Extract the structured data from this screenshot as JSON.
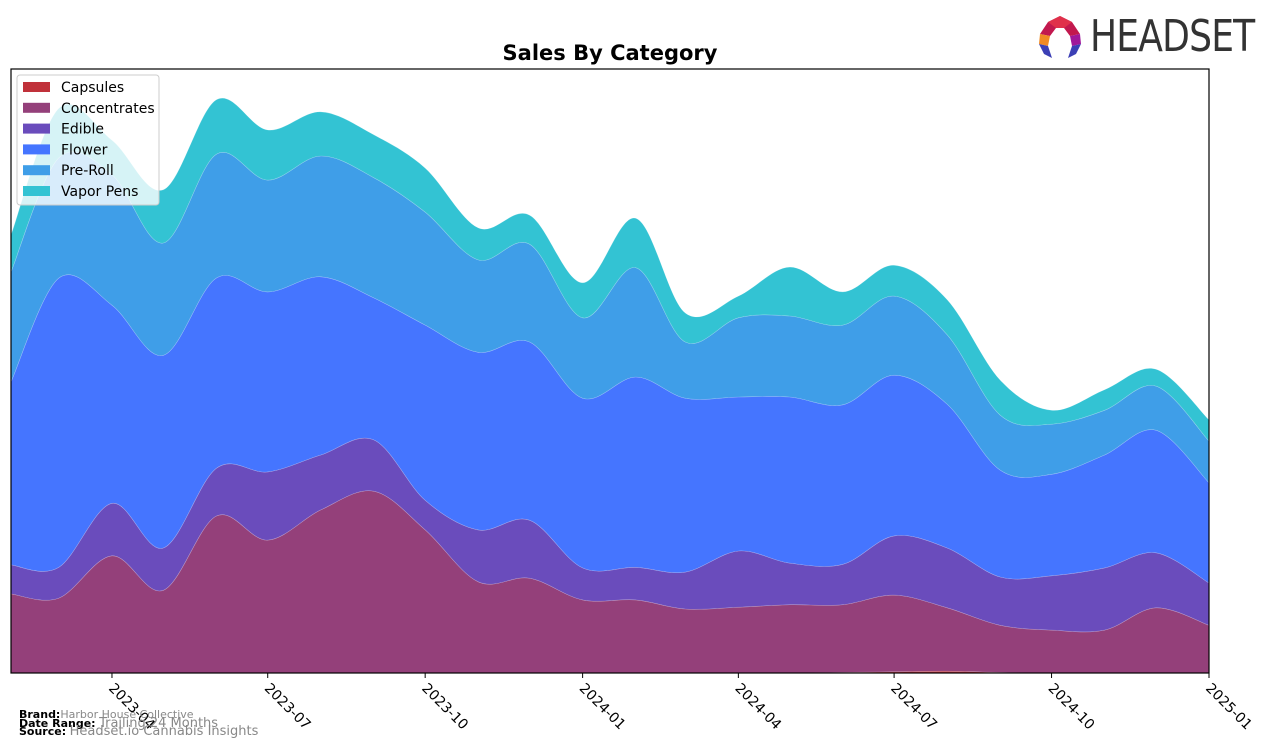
{
  "brand_logo": {
    "text": "HEADSET"
  },
  "footer": {
    "brand_label": "Brand:",
    "brand_value": "Harbor House Collective",
    "range_label": "Date Range:",
    "range_value": "Trailing 24 Months",
    "source_label": "Source:",
    "source_value": "Headset.io Cannabis Insights"
  },
  "chart_data": {
    "type": "area",
    "stacked": true,
    "smoothed": true,
    "title": "Sales By Category",
    "xlabel": "",
    "ylabel": "",
    "ylim": [
      0,
      100
    ],
    "grid": false,
    "legend_position": "top-left",
    "x": [
      "2023-02",
      "2023-03",
      "2023-04",
      "2023-05",
      "2023-06",
      "2023-07",
      "2023-08",
      "2023-09",
      "2023-10",
      "2023-11",
      "2023-12",
      "2024-01",
      "2024-02",
      "2024-03",
      "2024-04",
      "2024-05",
      "2024-06",
      "2024-07",
      "2024-08",
      "2024-09",
      "2024-10",
      "2024-11",
      "2024-12",
      "2025-01"
    ],
    "xticks": [
      "2023-04",
      "2023-07",
      "2023-10",
      "2024-01",
      "2024-04",
      "2024-07",
      "2024-10",
      "2025-01"
    ],
    "series": [
      {
        "name": "Capsules",
        "color": "#c0313a",
        "values": [
          0,
          0,
          0,
          0,
          0,
          0,
          0,
          0,
          0,
          0,
          0,
          0,
          0,
          0,
          0,
          0,
          0.1,
          0.2,
          0.3,
          0.1,
          0,
          0,
          0,
          0
        ]
      },
      {
        "name": "Concentrates",
        "color": "#94407a",
        "values": [
          13.1,
          12.4,
          19.4,
          13.7,
          26.0,
          22.0,
          27.0,
          30.1,
          23.7,
          15.1,
          15.7,
          12.1,
          12.1,
          10.6,
          10.9,
          11.3,
          11.2,
          12.7,
          10.5,
          7.8,
          7.1,
          7.1,
          10.8,
          7.9
        ]
      },
      {
        "name": "Edible",
        "color": "#6a4cbc",
        "values": [
          4.8,
          5.1,
          8.7,
          7.0,
          7.9,
          11.3,
          9.1,
          8.5,
          4.9,
          8.6,
          9.6,
          5.3,
          5.4,
          6.1,
          9.3,
          6.9,
          6.7,
          9.8,
          9.9,
          8.0,
          9.0,
          10.3,
          9.1,
          7.0
        ]
      },
      {
        "name": "Flower",
        "color": "#4575ff",
        "values": [
          30.3,
          47.9,
          32.8,
          31.9,
          31.5,
          29.8,
          29.5,
          23.5,
          29.0,
          29.4,
          29.5,
          28.1,
          31.5,
          28.8,
          25.5,
          27.5,
          26.4,
          26.6,
          23.8,
          17.7,
          16.8,
          18.7,
          20.3,
          16.6
        ]
      },
      {
        "name": "Pre-Roll",
        "color": "#3f9ee8",
        "values": [
          18.2,
          19.9,
          21.6,
          18.6,
          20.5,
          18.5,
          20.0,
          19.9,
          18.7,
          15.3,
          16.2,
          13.3,
          18.1,
          9.3,
          13.1,
          13.4,
          13.2,
          13.1,
          11.5,
          9.1,
          8.3,
          7.4,
          7.3,
          6.9
        ]
      },
      {
        "name": "Vapor Pens",
        "color": "#33c3d3",
        "values": [
          6.1,
          8.2,
          5.7,
          8.8,
          9.0,
          8.3,
          7.3,
          7.1,
          7.3,
          5.3,
          4.8,
          5.8,
          8.2,
          4.8,
          3.6,
          8.1,
          5.5,
          5.1,
          5.8,
          5.8,
          2.3,
          3.4,
          2.8,
          3.5
        ]
      }
    ]
  }
}
